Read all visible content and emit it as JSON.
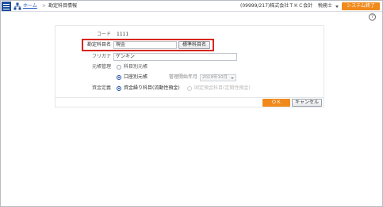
{
  "header": {
    "breadcrumb_home": "ホーム",
    "breadcrumb_sep": ">",
    "breadcrumb_current": "勘定科目情報",
    "company": "(09999/217)株式会社ＴＫＣ会計",
    "user": "税務士",
    "exit_label": "システム終了",
    "help_label": "?"
  },
  "form": {
    "code_label": "コード",
    "code_value": "1111",
    "account_name_label": "勘定科目名",
    "account_name_value": "現金",
    "standard_name_button": "標準科目名",
    "kana_label": "フリガナ",
    "kana_value": "ゲンキン",
    "balance_mgmt_label": "元帳管理",
    "balance_opt1": "科目別元帳",
    "balance_opt2": "口座別元帳",
    "mgmt_start_label": "管理開始年月",
    "mgmt_start_value": "2019年10月",
    "fund_label": "資金定義",
    "fund_opt1": "資金繰り科目(流動性預金)",
    "fund_opt2": "固定預金科目(定期性預金)",
    "ok_button": "ＯＫ",
    "cancel_button": "キャンセル"
  },
  "colors": {
    "accent": "#f08a1c",
    "brand": "#1d4e9e",
    "highlight": "#d9261c"
  }
}
